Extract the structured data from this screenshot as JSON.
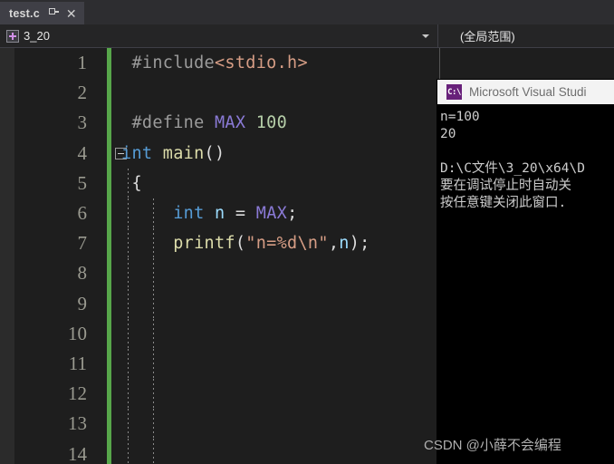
{
  "tab": {
    "label": "test.c",
    "pin_icon": "pin-icon",
    "close_icon": "close-icon"
  },
  "navbar": {
    "project_icon": "cpp-project-icon",
    "project": "3_20",
    "dropdown_icon": "chevron-down-icon",
    "scope": "(全局范围)"
  },
  "editor": {
    "lines": [
      {
        "number": "1",
        "fold": false,
        "guide": false,
        "guide2": false,
        "tokens": [
          {
            "text": " #include",
            "cls": "t-pre"
          },
          {
            "text": "<stdio.h>",
            "cls": "t-str"
          }
        ]
      },
      {
        "number": "2",
        "fold": false,
        "guide": false,
        "guide2": false,
        "tokens": []
      },
      {
        "number": "3",
        "fold": false,
        "guide": false,
        "guide2": false,
        "tokens": [
          {
            "text": " #define ",
            "cls": "t-pre"
          },
          {
            "text": "MAX",
            "cls": "t-macro"
          },
          {
            "text": " ",
            "cls": "t-plain"
          },
          {
            "text": "100",
            "cls": "t-num"
          }
        ]
      },
      {
        "number": "4",
        "fold": true,
        "guide": false,
        "guide2": false,
        "tokens": [
          {
            "text": "int",
            "cls": "t-kw"
          },
          {
            "text": " ",
            "cls": "t-plain"
          },
          {
            "text": "main",
            "cls": "t-fn"
          },
          {
            "text": "()",
            "cls": "t-punct"
          }
        ]
      },
      {
        "number": "5",
        "fold": false,
        "guide": true,
        "guide2": false,
        "tokens": [
          {
            "text": " {",
            "cls": "t-punct"
          }
        ]
      },
      {
        "number": "6",
        "fold": false,
        "guide": true,
        "guide2": true,
        "tokens": [
          {
            "text": "     ",
            "cls": "t-plain"
          },
          {
            "text": "int",
            "cls": "t-kw"
          },
          {
            "text": " ",
            "cls": "t-plain"
          },
          {
            "text": "n",
            "cls": "t-id"
          },
          {
            "text": " = ",
            "cls": "t-plain"
          },
          {
            "text": "MAX",
            "cls": "t-macro"
          },
          {
            "text": ";",
            "cls": "t-punct"
          }
        ]
      },
      {
        "number": "7",
        "fold": false,
        "guide": true,
        "guide2": true,
        "tokens": [
          {
            "text": "     ",
            "cls": "t-plain"
          },
          {
            "text": "printf",
            "cls": "t-fn"
          },
          {
            "text": "(",
            "cls": "t-punct"
          },
          {
            "text": "\"n=%d\\n\"",
            "cls": "t-str"
          },
          {
            "text": ",",
            "cls": "t-punct"
          },
          {
            "text": "n",
            "cls": "t-id"
          },
          {
            "text": ");",
            "cls": "t-punct"
          }
        ]
      },
      {
        "number": "8",
        "fold": false,
        "guide": true,
        "guide2": true,
        "tokens": []
      },
      {
        "number": "9",
        "fold": false,
        "guide": true,
        "guide2": true,
        "tokens": []
      },
      {
        "number": "10",
        "fold": false,
        "guide": true,
        "guide2": true,
        "tokens": []
      },
      {
        "number": "11",
        "fold": false,
        "guide": true,
        "guide2": true,
        "tokens": []
      },
      {
        "number": "12",
        "fold": false,
        "guide": true,
        "guide2": true,
        "tokens": []
      },
      {
        "number": "13",
        "fold": false,
        "guide": true,
        "guide2": true,
        "tokens": []
      },
      {
        "number": "14",
        "fold": false,
        "guide": true,
        "guide2": true,
        "tokens": []
      }
    ]
  },
  "console": {
    "icon_text": "C:\\",
    "title": "Microsoft Visual Studi",
    "lines": [
      "n=100",
      "20",
      "",
      "D:\\C文件\\3_20\\x64\\D",
      "要在调试停止时自动关",
      "按任意键关闭此窗口."
    ]
  },
  "watermark": {
    "text": "CSDN @小薛不会编程"
  },
  "colors": {
    "editor_bg": "#1e1e1e",
    "tab_active": "#3f3f46",
    "tabstrip_bg": "#2d2d30",
    "navbar_bg": "#252526",
    "change_bar": "#57a64a",
    "console_bg": "#000000",
    "console_title_bg": "#f3f3f3",
    "vs_purple": "#68217a",
    "keyword": "#569cd6",
    "string": "#d69d85",
    "macro": "#8a7ad6",
    "number": "#b5cea8",
    "function": "#dcdcaa",
    "identifier": "#9cdcfe",
    "preprocessor": "#9b9b9b",
    "linenumber": "#9a9a90"
  }
}
